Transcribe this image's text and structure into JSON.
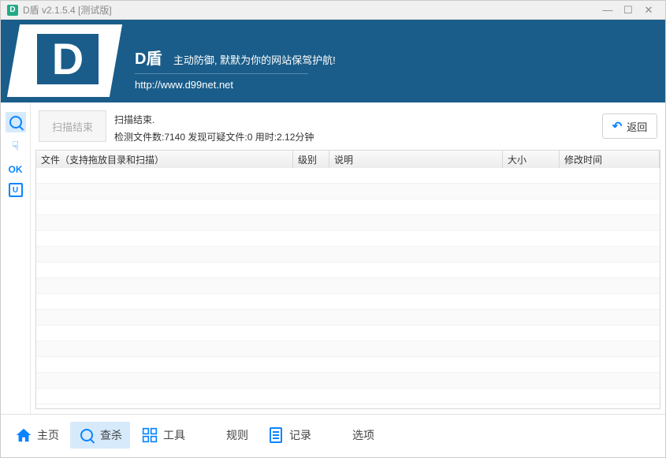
{
  "titlebar": {
    "icon_letter": "D",
    "title": "D盾 v2.1.5.4 [测试版]"
  },
  "banner": {
    "logo_letter": "D",
    "name": "D盾",
    "tagline": "主动防御, 默默为你的网站保驾护航!",
    "url": "http://www.d99net.net"
  },
  "sidebar": {
    "ok_label": "OK",
    "sq_label": "U"
  },
  "status": {
    "end_button": "扫描结束",
    "line1": "扫描结束.",
    "line2": "检测文件数:7140 发现可疑文件:0 用时:2.12分钟",
    "back_button": "返回"
  },
  "table": {
    "headers": {
      "file": "文件（支持拖放目录和扫描）",
      "level": "级别",
      "desc": "说明",
      "size": "大小",
      "mtime": "修改时间"
    },
    "rows": []
  },
  "bottombar": {
    "home": "主页",
    "scan": "查杀",
    "tools": "工具",
    "rules": "规则",
    "logs": "记录",
    "options": "选项"
  }
}
